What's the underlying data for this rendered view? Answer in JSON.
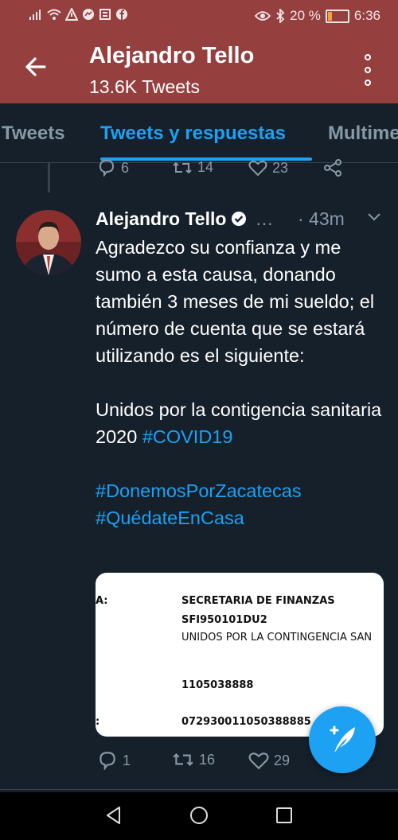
{
  "status_bar": {
    "battery_percent": "20 %",
    "battery_level": 0.2,
    "time": "6:36",
    "icons_left": [
      "signal-icon",
      "wifi-icon",
      "warning-icon",
      "messenger-icon",
      "news-icon",
      "facebook-icon"
    ],
    "icons_right": [
      "eye-icon",
      "bluetooth-icon",
      "battery-icon"
    ]
  },
  "header": {
    "title": "Alejandro Tello",
    "subtitle": "13.6K Tweets"
  },
  "tabs": [
    {
      "label": "Tweets",
      "active": false
    },
    {
      "label": "Tweets y respuestas",
      "active": true
    },
    {
      "label": "Multime",
      "active": false
    }
  ],
  "prev_tweet_actions": {
    "replies": "6",
    "retweets": "14",
    "likes": "23"
  },
  "tweet": {
    "author": "Alejandro Tello",
    "handle": "…",
    "time": "· 43m",
    "text_lines": [
      "Agradezco su confianza y me sumo a esta causa, donando también 3 meses de mi sueldo; el número de cuenta que se estará utilizando es el siguiente:",
      "Unidos por la contigencia sanitaria 2020",
      "#COVID19",
      "#DonemosPorZacatecas",
      "#QuédateEnCasa"
    ],
    "media_lines": [
      "A:",
      "SECRETARIA DE FINANZAS",
      "SFI950101DU2",
      "UNIDOS POR LA CONTINGENCIA SAN",
      "1105038888",
      ":",
      "072930011050388885"
    ],
    "replies": "1",
    "retweets": "16",
    "likes": "29"
  },
  "colors": {
    "header_bg": "#963f3f",
    "background": "#15202b",
    "accent": "#1da1f2",
    "muted": "#8899a6"
  }
}
